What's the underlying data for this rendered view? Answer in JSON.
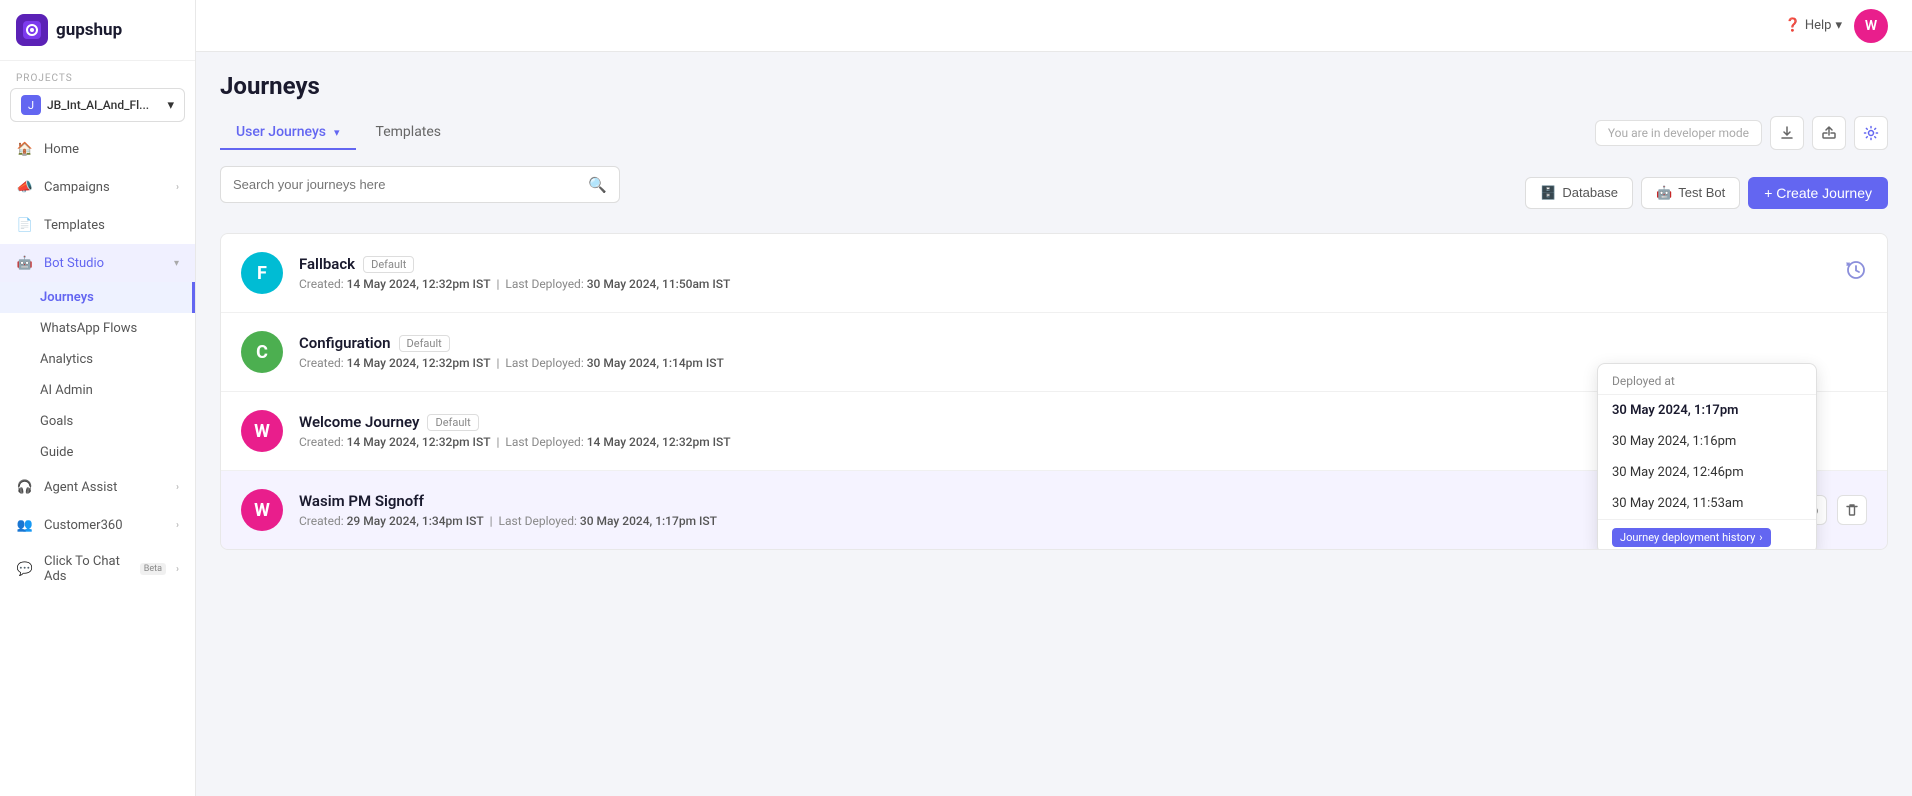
{
  "sidebar": {
    "logo_text": "gupshup",
    "projects_label": "PROJECTS",
    "project_name": "JB_Int_AI_And_Fl...",
    "project_initial": "J",
    "nav_items": [
      {
        "id": "home",
        "label": "Home",
        "icon": "🏠"
      },
      {
        "id": "campaigns",
        "label": "Campaigns",
        "icon": "📣",
        "has_arrow": true
      },
      {
        "id": "templates",
        "label": "Templates",
        "icon": "📄"
      },
      {
        "id": "bot-studio",
        "label": "Bot Studio",
        "icon": "🤖",
        "has_arrow": true,
        "active": true
      },
      {
        "id": "journeys",
        "label": "Journeys",
        "icon": "",
        "sub": true,
        "active": true
      },
      {
        "id": "whatsapp-flows",
        "label": "WhatsApp Flows",
        "icon": "",
        "sub": true
      },
      {
        "id": "analytics",
        "label": "Analytics",
        "icon": "",
        "sub": true
      },
      {
        "id": "ai-admin",
        "label": "AI Admin",
        "icon": "",
        "sub": true
      },
      {
        "id": "goals",
        "label": "Goals",
        "icon": "",
        "sub": true
      },
      {
        "id": "guide",
        "label": "Guide",
        "icon": "",
        "sub": true
      },
      {
        "id": "agent-assist",
        "label": "Agent Assist",
        "icon": "🎧",
        "has_arrow": true
      },
      {
        "id": "customer360",
        "label": "Customer360",
        "icon": "👥",
        "has_arrow": true
      },
      {
        "id": "click-to-chat",
        "label": "Click To Chat Ads",
        "icon": "💬",
        "has_arrow": true,
        "beta": true
      }
    ]
  },
  "topbar": {
    "help_label": "Help",
    "user_initial": "W"
  },
  "page": {
    "title": "Journeys",
    "tabs": [
      {
        "id": "user-journeys",
        "label": "User Journeys",
        "active": true,
        "has_dropdown": true
      },
      {
        "id": "templates",
        "label": "Templates",
        "active": false
      }
    ],
    "dev_mode_label": "You are in developer mode",
    "search_placeholder": "Search your journeys here",
    "btn_database": "Database",
    "btn_test_bot": "Test Bot",
    "btn_create_journey": "+ Create Journey"
  },
  "journeys": [
    {
      "id": "fallback",
      "initial": "F",
      "bg_color": "#00bcd4",
      "name": "Fallback",
      "badge": "Default",
      "created": "14 May 2024, 12:32pm IST",
      "last_deployed": "30 May 2024, 11:50am IST",
      "highlighted": false,
      "show_history_icon": true
    },
    {
      "id": "configuration",
      "initial": "C",
      "bg_color": "#4caf50",
      "name": "Configuration",
      "badge": "Default",
      "created": "14 May 2024, 12:32pm IST",
      "last_deployed": "30 May 2024, 1:14pm IST",
      "highlighted": false,
      "show_history_icon": false
    },
    {
      "id": "welcome-journey",
      "initial": "W",
      "bg_color": "#e91e8c",
      "name": "Welcome Journey",
      "badge": "Default",
      "created": "14 May 2024, 12:32pm IST",
      "last_deployed": "14 May 2024, 12:32pm IST",
      "highlighted": false,
      "show_history_icon": false
    },
    {
      "id": "wasim-pm-signoff",
      "initial": "W",
      "bg_color": "#e91e8c",
      "name": "Wasim PM Signoff",
      "badge": "",
      "created": "29 May 2024, 1:34pm IST",
      "last_deployed": "30 May 2024, 1:17pm IST",
      "highlighted": true,
      "show_history_icon": false
    }
  ],
  "deployed_popup": {
    "header": "Deployed at",
    "items": [
      {
        "label": "30 May 2024, 1:17pm",
        "selected": true
      },
      {
        "label": "30 May 2024, 1:16pm",
        "selected": false
      },
      {
        "label": "30 May 2024, 12:46pm",
        "selected": false
      },
      {
        "label": "30 May 2024, 11:53am",
        "selected": false
      }
    ],
    "footer_badge": "Journey deployment history",
    "footer_arrow": "›"
  }
}
